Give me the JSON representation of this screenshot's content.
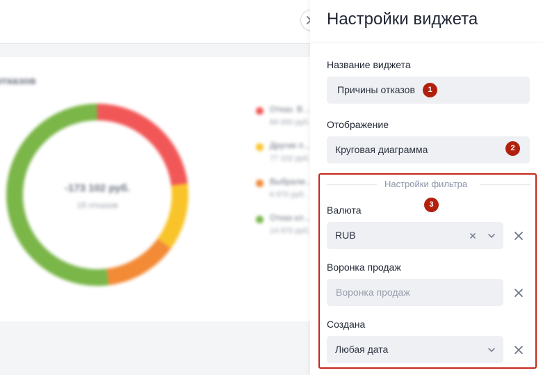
{
  "background": {
    "chart_title": "отказов",
    "donut_total": "-173 102 руб.",
    "donut_subtitle": "18 отказов",
    "legend": [
      {
        "label": "Отказ. В…",
        "value": "84 000 руб.",
        "color": "#f25757"
      },
      {
        "label": "Другие п…",
        "value": "77 102 руб.",
        "color": "#f9c429"
      },
      {
        "label": "Выбрали…",
        "value": "6 970 руб.",
        "color": "#f28a36"
      },
      {
        "label": "Отказ кл…",
        "value": "14 970 руб.",
        "color": "#7ab648"
      }
    ],
    "segments": [
      {
        "label": "Отказ. В…",
        "fraction": 0.23,
        "color": "#f25757"
      },
      {
        "label": "Другие п…",
        "fraction": 0.12,
        "color": "#f9c429"
      },
      {
        "label": "Выбрали…",
        "fraction": 0.13,
        "color": "#f28a36"
      },
      {
        "label": "Отказ кл…",
        "fraction": 0.52,
        "color": "#7ab648"
      }
    ]
  },
  "panel": {
    "title": "Настройки виджета",
    "close_icon": "close-icon",
    "name_label": "Название виджета",
    "name_value": "Причины отказов",
    "display_label": "Отображение",
    "display_value": "Круговая диаграмма",
    "filter_section_title": "Настройки фильтра",
    "currency_label": "Валюта",
    "currency_value": "RUB",
    "funnel_label": "Воронка продаж",
    "funnel_placeholder": "Воронка продаж",
    "created_label": "Создана",
    "created_value": "Любая дата"
  },
  "annotations": {
    "badge_1": "1",
    "badge_2": "2",
    "badge_3": "3",
    "badge_color": "#b2200d",
    "highlight_color": "#c4271b"
  }
}
